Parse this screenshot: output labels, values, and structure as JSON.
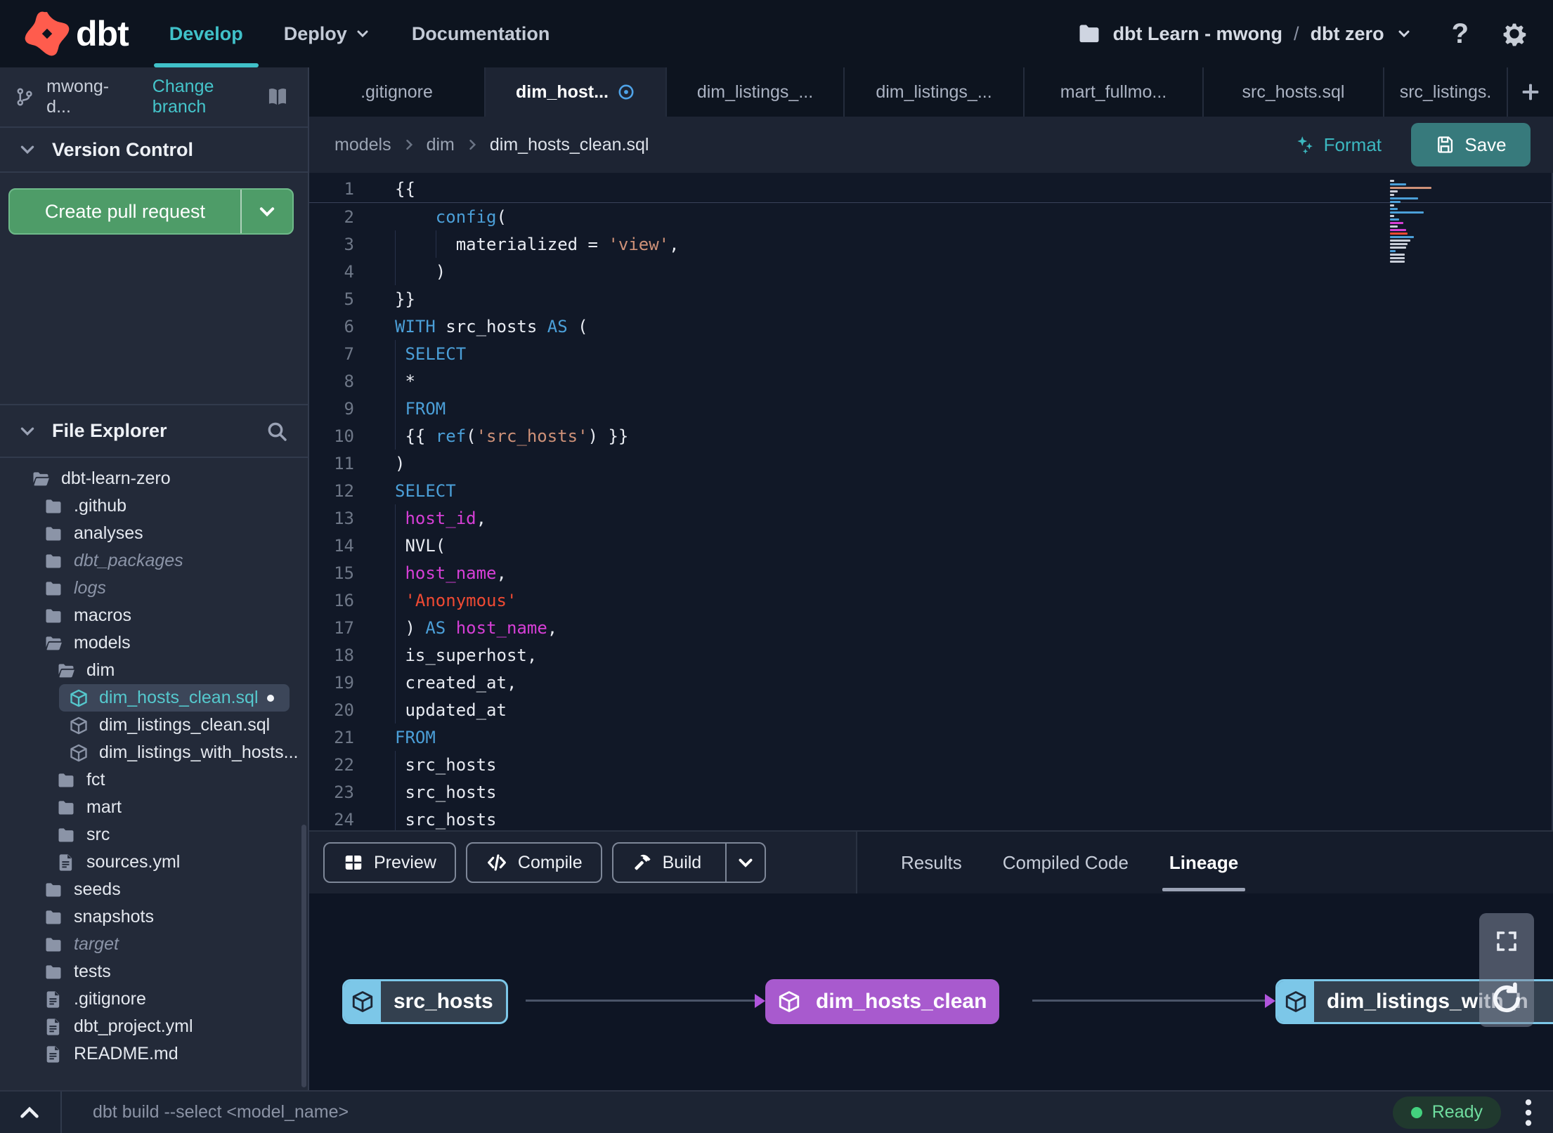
{
  "colors": {
    "accent_teal": "#40c1c9",
    "accent_green": "#4e9c68",
    "save_teal": "#377a7c",
    "selected_purple": "#a85ace",
    "node_blue": "#7cc7e8",
    "logo_orange": "#ff5c4d",
    "status_green": "#43d17e",
    "keyword_blue": "#4b9fd8",
    "string_orange": "#ce9178",
    "error_red": "#f04a33",
    "ident_magenta": "#d63fd6"
  },
  "topnav": {
    "logo_text": "dbt",
    "links": [
      {
        "label": "Develop",
        "active": true,
        "dropdown": false
      },
      {
        "label": "Deploy",
        "active": false,
        "dropdown": true
      },
      {
        "label": "Documentation",
        "active": false,
        "dropdown": false
      }
    ],
    "project_picker": {
      "project": "dbt Learn - mwong",
      "separator": "/",
      "environment": "dbt zero"
    },
    "help_label": "?"
  },
  "sidebar": {
    "branch_bar": {
      "branch": "mwong-d...",
      "change_branch": "Change branch"
    },
    "version_control": {
      "title": "Version Control",
      "create_pr_label": "Create pull request"
    },
    "file_explorer": {
      "title": "File Explorer"
    },
    "tree": [
      {
        "label": "dbt-learn-zero",
        "icon": "folder-open",
        "level": 1
      },
      {
        "label": ".github",
        "icon": "folder",
        "level": 2
      },
      {
        "label": "analyses",
        "icon": "folder",
        "level": 2
      },
      {
        "label": "dbt_packages",
        "icon": "folder",
        "level": 2,
        "dim": true
      },
      {
        "label": "logs",
        "icon": "folder",
        "level": 2,
        "dim": true
      },
      {
        "label": "macros",
        "icon": "folder",
        "level": 2
      },
      {
        "label": "models",
        "icon": "folder-open",
        "level": 2
      },
      {
        "label": "dim",
        "icon": "folder-open",
        "level": 3
      },
      {
        "label": "dim_hosts_clean.sql",
        "icon": "cube",
        "level": 4,
        "selected": true,
        "modified": true
      },
      {
        "label": "dim_listings_clean.sql",
        "icon": "cube",
        "level": 4
      },
      {
        "label": "dim_listings_with_hosts...",
        "icon": "cube",
        "level": 4
      },
      {
        "label": "fct",
        "icon": "folder",
        "level": 3
      },
      {
        "label": "mart",
        "icon": "folder",
        "level": 3
      },
      {
        "label": "src",
        "icon": "folder",
        "level": 3
      },
      {
        "label": "sources.yml",
        "icon": "file",
        "level": 3
      },
      {
        "label": "seeds",
        "icon": "folder",
        "level": 2
      },
      {
        "label": "snapshots",
        "icon": "folder",
        "level": 2
      },
      {
        "label": "target",
        "icon": "folder",
        "level": 2,
        "dim": true
      },
      {
        "label": "tests",
        "icon": "folder",
        "level": 2
      },
      {
        "label": ".gitignore",
        "icon": "file",
        "level": 2
      },
      {
        "label": "dbt_project.yml",
        "icon": "file",
        "level": 2
      },
      {
        "label": "README.md",
        "icon": "file",
        "level": 2
      }
    ]
  },
  "tabs": [
    {
      "label": ".gitignore",
      "active": false,
      "modified": false
    },
    {
      "label": "dim_host...",
      "active": true,
      "modified": true
    },
    {
      "label": "dim_listings_...",
      "active": false,
      "modified": false
    },
    {
      "label": "dim_listings_...",
      "active": false,
      "modified": false
    },
    {
      "label": "mart_fullmo...",
      "active": false,
      "modified": false
    },
    {
      "label": "src_hosts.sql",
      "active": false,
      "modified": false
    },
    {
      "label": "src_listings.",
      "active": false,
      "modified": false
    }
  ],
  "breadcrumb": {
    "segments": [
      "models",
      "dim",
      "dim_hosts_clean.sql"
    ],
    "format_label": "Format",
    "save_label": "Save"
  },
  "editor": {
    "lines": [
      {
        "n": 1,
        "active": true,
        "guides": [],
        "segs": [
          [
            "{{",
            "p"
          ]
        ]
      },
      {
        "n": 2,
        "guides": [],
        "segs": [
          [
            "    ",
            "p"
          ],
          [
            "config",
            "kw"
          ],
          [
            "(",
            "p"
          ]
        ]
      },
      {
        "n": 3,
        "guides": [
          0,
          4
        ],
        "segs": [
          [
            "      materialized = ",
            "p"
          ],
          [
            "'view'",
            "str"
          ],
          [
            ",",
            "p"
          ]
        ]
      },
      {
        "n": 4,
        "guides": [
          0
        ],
        "segs": [
          [
            "    )",
            "p"
          ]
        ]
      },
      {
        "n": 5,
        "guides": [],
        "segs": [
          [
            "}}",
            "p"
          ]
        ]
      },
      {
        "n": 6,
        "guides": [],
        "segs": [
          [
            "WITH",
            "kw"
          ],
          [
            " src_hosts ",
            "p"
          ],
          [
            "AS",
            "kw"
          ],
          [
            " (",
            "p"
          ]
        ]
      },
      {
        "n": 7,
        "guides": [
          0
        ],
        "segs": [
          [
            " ",
            "p"
          ],
          [
            "SELECT",
            "kw"
          ]
        ]
      },
      {
        "n": 8,
        "guides": [
          0
        ],
        "segs": [
          [
            " *",
            "p"
          ]
        ]
      },
      {
        "n": 9,
        "guides": [
          0
        ],
        "segs": [
          [
            " ",
            "p"
          ],
          [
            "FROM",
            "kw"
          ]
        ]
      },
      {
        "n": 10,
        "guides": [
          0
        ],
        "segs": [
          [
            " {{ ",
            "p"
          ],
          [
            "ref",
            "kw"
          ],
          [
            "(",
            "p"
          ],
          [
            "'src_hosts'",
            "str"
          ],
          [
            ") }}",
            "p"
          ]
        ]
      },
      {
        "n": 11,
        "guides": [],
        "segs": [
          [
            ")",
            "p"
          ]
        ]
      },
      {
        "n": 12,
        "guides": [],
        "segs": [
          [
            "SELECT",
            "kw"
          ]
        ]
      },
      {
        "n": 13,
        "guides": [
          0
        ],
        "segs": [
          [
            " ",
            "p"
          ],
          [
            "host_id",
            "id"
          ],
          [
            ",",
            "p"
          ]
        ]
      },
      {
        "n": 14,
        "guides": [
          0
        ],
        "segs": [
          [
            " NVL(",
            "p"
          ]
        ]
      },
      {
        "n": 15,
        "guides": [
          0
        ],
        "segs": [
          [
            " ",
            "p"
          ],
          [
            "host_name",
            "id"
          ],
          [
            ",",
            "p"
          ]
        ]
      },
      {
        "n": 16,
        "guides": [
          0
        ],
        "segs": [
          [
            " ",
            "p"
          ],
          [
            "'Anonymous'",
            "err"
          ]
        ]
      },
      {
        "n": 17,
        "guides": [
          0
        ],
        "segs": [
          [
            " ) ",
            "p"
          ],
          [
            "AS",
            "kw"
          ],
          [
            " ",
            "p"
          ],
          [
            "host_name",
            "id"
          ],
          [
            ",",
            "p"
          ]
        ]
      },
      {
        "n": 18,
        "guides": [
          0
        ],
        "segs": [
          [
            " is_superhost,",
            "p"
          ]
        ]
      },
      {
        "n": 19,
        "guides": [
          0
        ],
        "segs": [
          [
            " created_at,",
            "p"
          ]
        ]
      },
      {
        "n": 20,
        "guides": [
          0
        ],
        "segs": [
          [
            " updated_at",
            "p"
          ]
        ]
      },
      {
        "n": 21,
        "guides": [],
        "segs": [
          [
            "FROM",
            "kw"
          ]
        ]
      },
      {
        "n": 22,
        "guides": [
          0
        ],
        "segs": [
          [
            " src_hosts",
            "p"
          ]
        ]
      },
      {
        "n": 23,
        "guides": [
          0
        ],
        "segs": [
          [
            " src_hosts",
            "p"
          ]
        ]
      },
      {
        "n": 24,
        "guides": [
          0
        ],
        "segs": [
          [
            " src_hosts",
            "p"
          ]
        ]
      }
    ]
  },
  "bottom_panel": {
    "preview_label": "Preview",
    "compile_label": "Compile",
    "build_label": "Build",
    "tabs": [
      {
        "label": "Results",
        "active": false
      },
      {
        "label": "Compiled Code",
        "active": false
      },
      {
        "label": "Lineage",
        "active": true
      }
    ]
  },
  "lineage": {
    "nodes": [
      {
        "label": "src_hosts",
        "variant": "model"
      },
      {
        "label": "dim_hosts_clean",
        "variant": "selected"
      },
      {
        "label": "dim_listings_with_h",
        "variant": "model"
      }
    ]
  },
  "status_bar": {
    "command": "dbt build --select <model_name>",
    "status_label": "Ready"
  }
}
